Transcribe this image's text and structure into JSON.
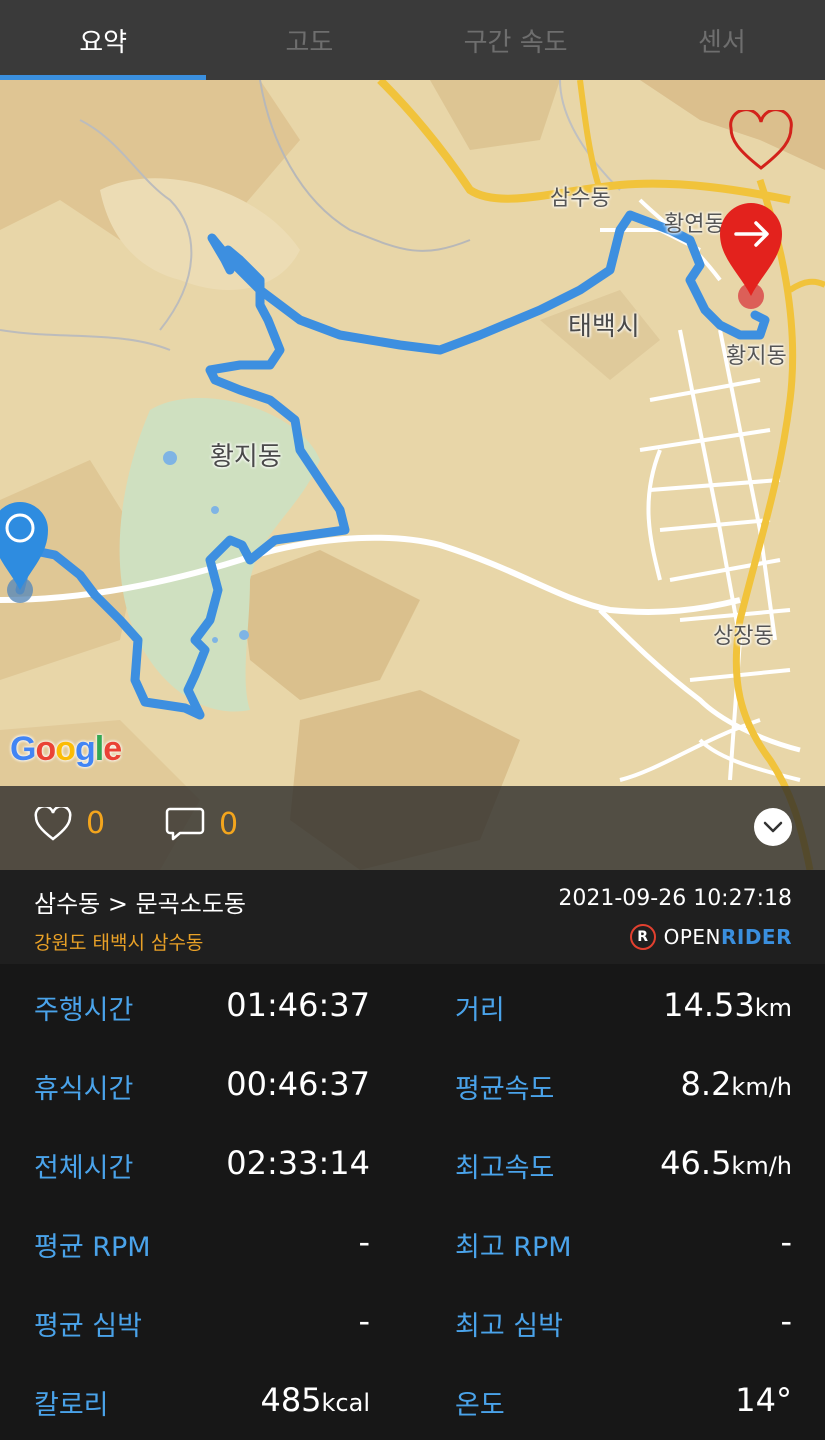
{
  "tabs": [
    {
      "label": "요약",
      "active": true
    },
    {
      "label": "고도",
      "active": false
    },
    {
      "label": "구간 속도",
      "active": false
    },
    {
      "label": "센서",
      "active": false
    }
  ],
  "map": {
    "labels": {
      "samsu": "삼수동",
      "hwangyeon": "황연동",
      "taebaek": "태백시",
      "hwangji_right": "황지동",
      "hwangji_left": "황지동",
      "sangjang": "상장동"
    },
    "google_logo": "Google",
    "favorite_icon": "heart-outline-icon",
    "start_marker_icon": "start-circle-icon",
    "end_marker_icon": "arrow-right-icon",
    "route_color": "#3d8fe0",
    "end_marker_color": "#e3221d",
    "start_marker_color": "#2e8ce0"
  },
  "social": {
    "like_count": "0",
    "comment_count": "0"
  },
  "ride": {
    "title": "삼수동 > 문곡소도동",
    "location": "강원도 태백시 삼수동",
    "datetime": "2021-09-26 10:27:18",
    "brand_open": "OPEN",
    "brand_rider": "RIDER",
    "brand_badge": "R"
  },
  "stats": {
    "ride_time_label": "주행시간",
    "ride_time": "01:46:37",
    "distance_label": "거리",
    "distance": "14.53",
    "distance_unit": "km",
    "rest_time_label": "휴식시간",
    "rest_time": "00:46:37",
    "avg_speed_label": "평균속도",
    "avg_speed": "8.2",
    "avg_speed_unit": "km/h",
    "total_time_label": "전체시간",
    "total_time": "02:33:14",
    "max_speed_label": "최고속도",
    "max_speed": "46.5",
    "max_speed_unit": "km/h",
    "avg_rpm_label": "평균 RPM",
    "avg_rpm": "-",
    "max_rpm_label": "최고 RPM",
    "max_rpm": "-",
    "avg_hr_label": "평균 심박",
    "avg_hr": "-",
    "max_hr_label": "최고 심박",
    "max_hr": "-",
    "calories_label": "칼로리",
    "calories": "485",
    "calories_unit": "kcal",
    "temp_label": "온도",
    "temp": "14°"
  }
}
